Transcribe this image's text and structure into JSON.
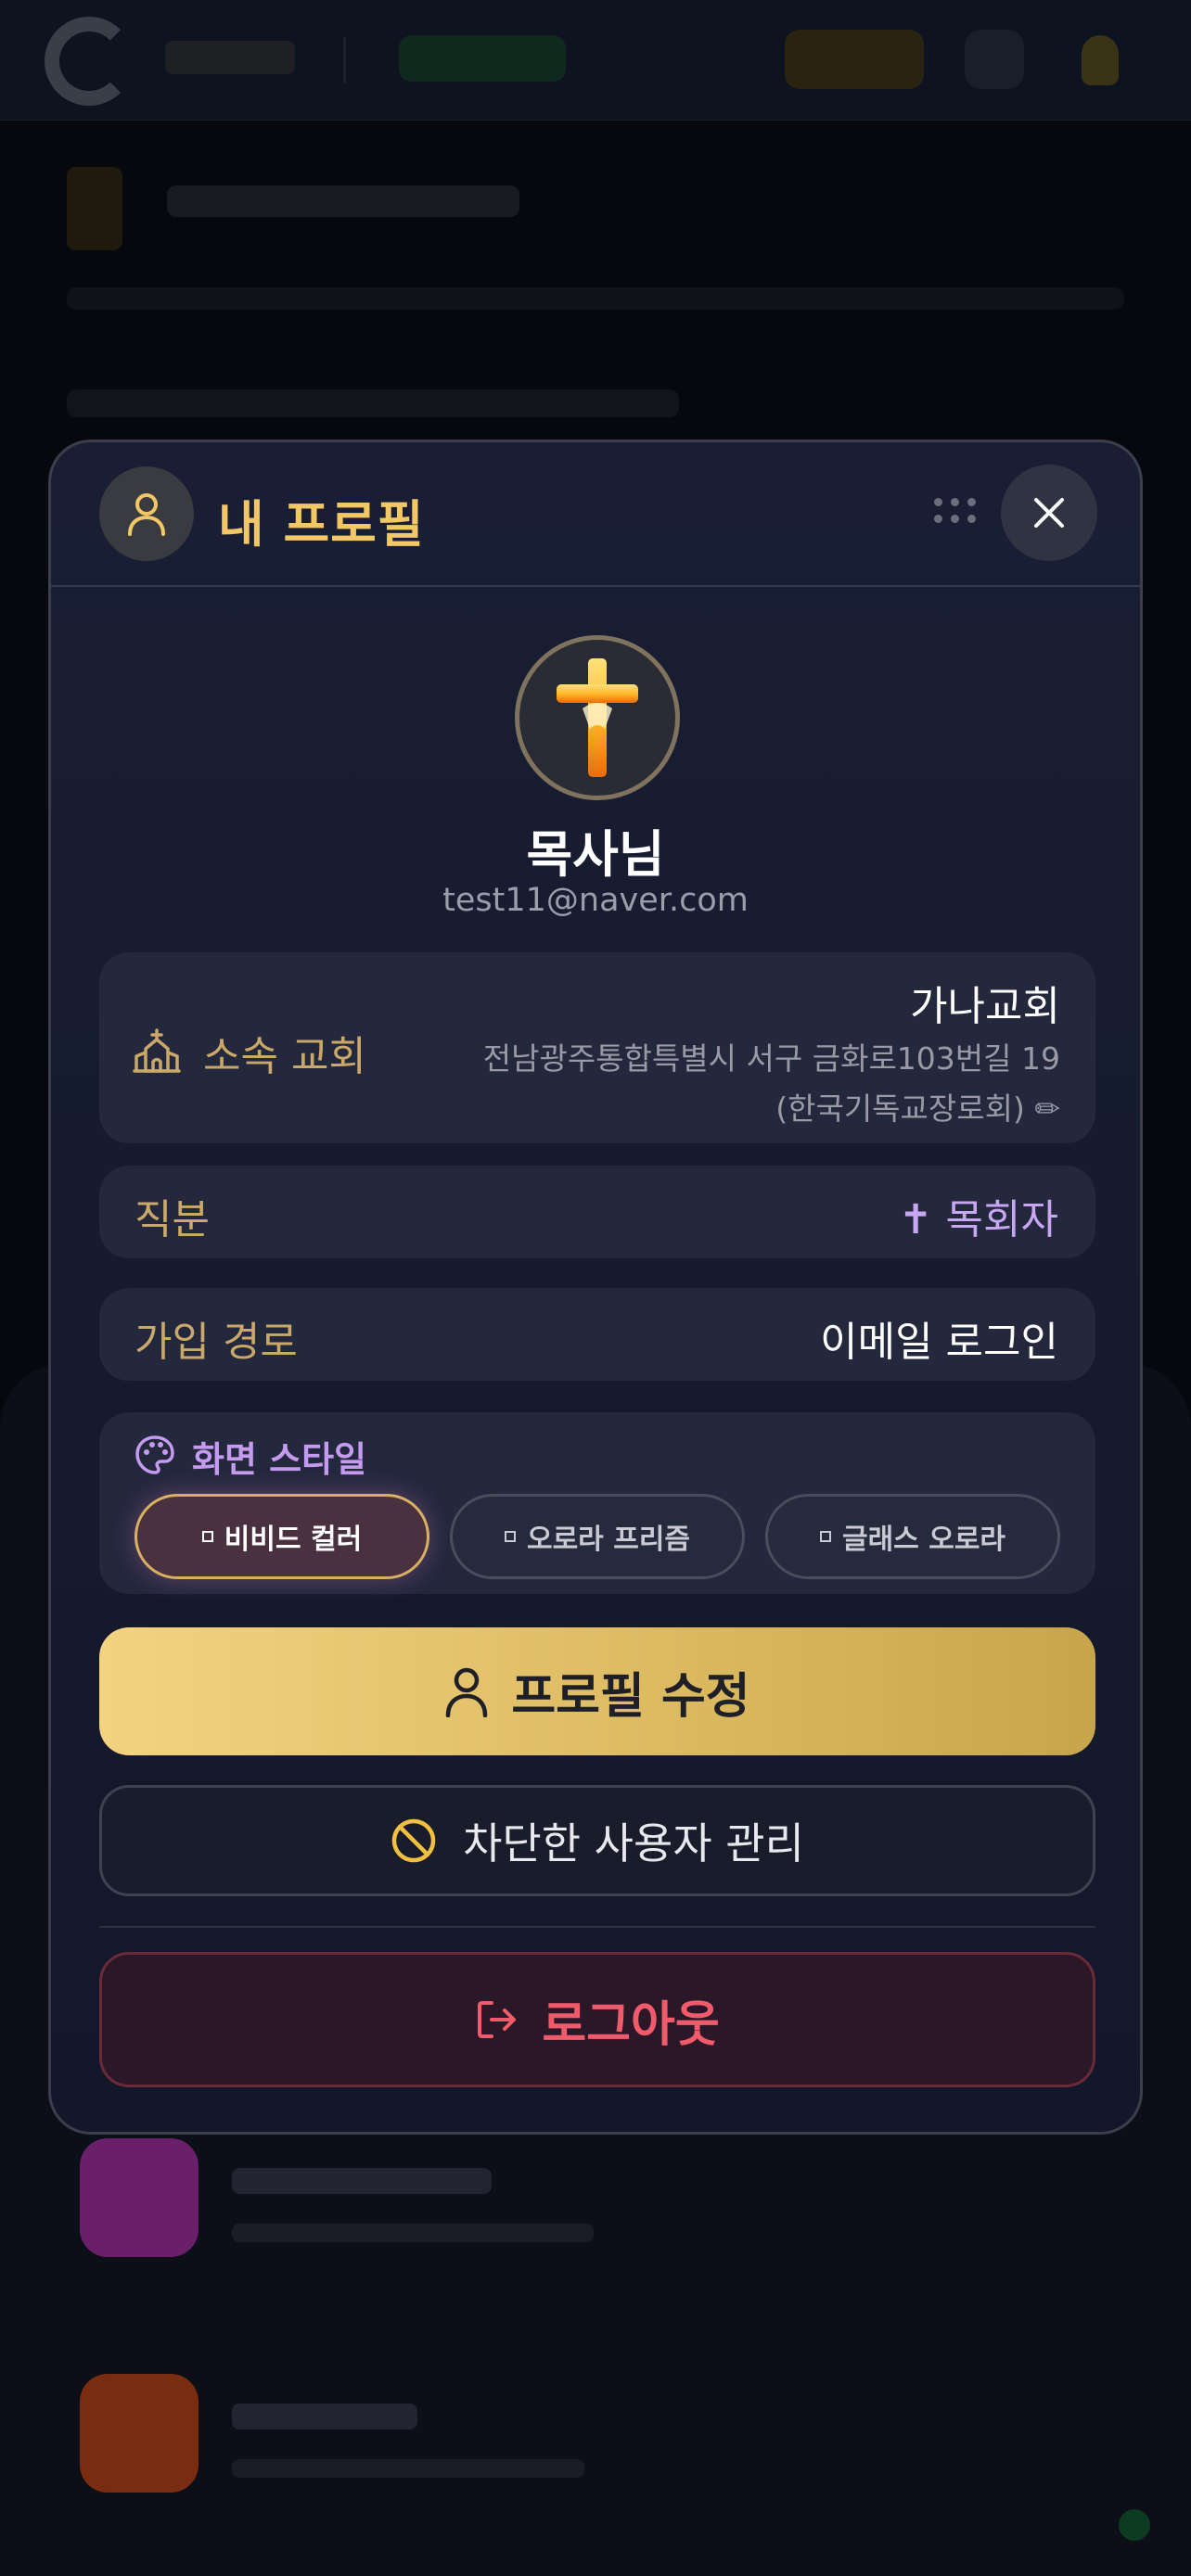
{
  "header": {
    "title": "내 프로필",
    "title_color": "#f2c766"
  },
  "profile": {
    "name": "목사님",
    "email": "test11@naver.com",
    "avatar_icon": "cross-icon"
  },
  "church": {
    "label": "소속 교회",
    "name": "가나교회",
    "address": "전남광주통합특별시 서구 금화로103번길 19",
    "denomination": "(한국기독교장로회) ✏"
  },
  "role": {
    "label": "직분",
    "value": "✝ 목회자"
  },
  "join": {
    "label": "가입 경로",
    "value": "이메일 로그인"
  },
  "screen_style": {
    "title": "화면 스타일",
    "options": [
      {
        "label": "비비드 컬러",
        "active": true
      },
      {
        "label": "오로라 프리즘",
        "active": false
      },
      {
        "label": "글래스 오로라",
        "active": false
      }
    ]
  },
  "actions": {
    "edit_profile": "프로필 수정",
    "blocked_users": "차단한 사용자 관리",
    "logout": "로그아웃"
  },
  "colors": {
    "accent_gold": "#f2c766",
    "label_gold": "#c9a86a",
    "role_purple": "#c7a6f2",
    "logout_red": "#ef5b6a"
  }
}
